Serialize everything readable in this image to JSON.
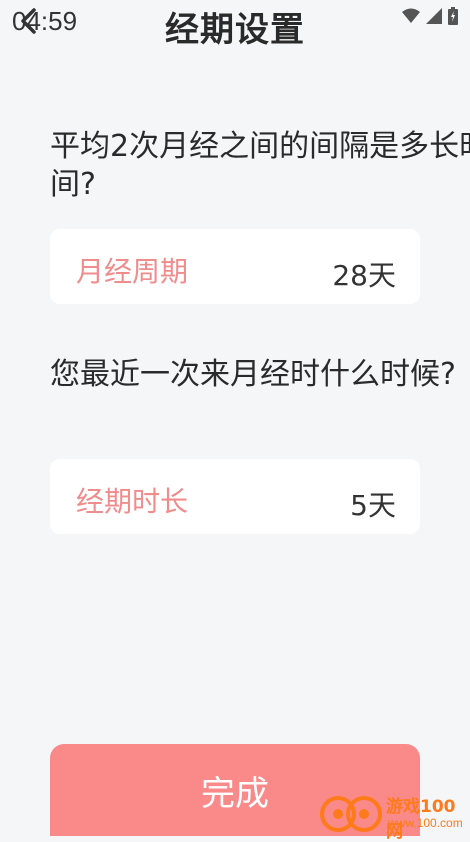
{
  "status_bar": {
    "time": "04:59"
  },
  "header": {
    "title": "经期设置"
  },
  "questions": [
    {
      "text": "平均2次月经之间的间隔是多长时间?",
      "field_label": "月经周期",
      "field_value": "28天"
    },
    {
      "text": "您最近一次来月经时什么时候?",
      "field_label": "经期时长",
      "field_value": "5天"
    }
  ],
  "footer": {
    "done_label": "完成"
  },
  "watermark": {
    "brand": "游戏100网",
    "url": "www.100.com"
  },
  "colors": {
    "accent": "#fa8a8a",
    "label": "#f08c8c",
    "background": "#f5f6f8"
  }
}
